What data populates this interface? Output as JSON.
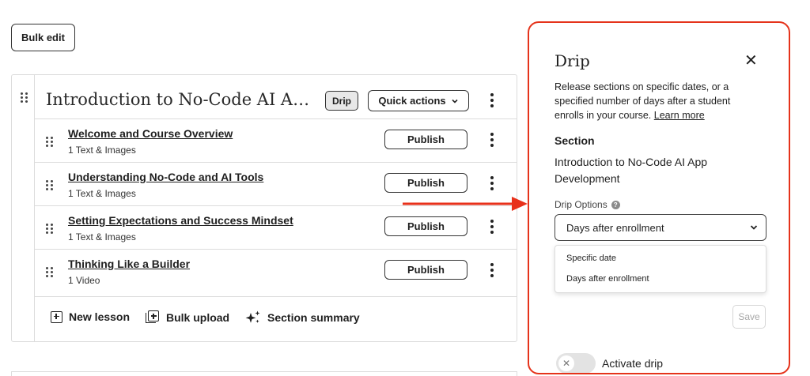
{
  "toolbar": {
    "bulk_edit_label": "Bulk edit"
  },
  "section": {
    "title": "Introduction to No-Code AI App Development",
    "drip_badge": "Drip",
    "quick_actions_label": "Quick actions",
    "lessons": [
      {
        "title": "Welcome and Course Overview",
        "subtitle": "1 Text & Images",
        "action": "Publish"
      },
      {
        "title": "Understanding No-Code and AI Tools",
        "subtitle": "1 Text & Images",
        "action": "Publish"
      },
      {
        "title": "Setting Expectations and Success Mindset",
        "subtitle": "1 Text & Images",
        "action": "Publish"
      },
      {
        "title": "Thinking Like a Builder",
        "subtitle": "1 Video",
        "action": "Publish"
      }
    ],
    "footer": {
      "new_lesson": "New lesson",
      "bulk_upload": "Bulk upload",
      "section_summary": "Section summary"
    }
  },
  "drip_panel": {
    "title": "Drip",
    "close_icon": "close-icon",
    "description": "Release sections on specific dates, or a specified number of days after a student enrolls in your course.",
    "learn_more": "Learn more",
    "section_label": "Section",
    "section_name": "Introduction to No-Code AI App Development",
    "drip_options_label": "Drip Options",
    "selected_option": "Days after enrollment",
    "options": [
      "Specific date",
      "Days after enrollment"
    ],
    "save_label": "Save",
    "activate_label": "Activate drip",
    "activate_on": false
  },
  "colors": {
    "highlight": "#e5331b",
    "arrow": "#e8311b"
  }
}
